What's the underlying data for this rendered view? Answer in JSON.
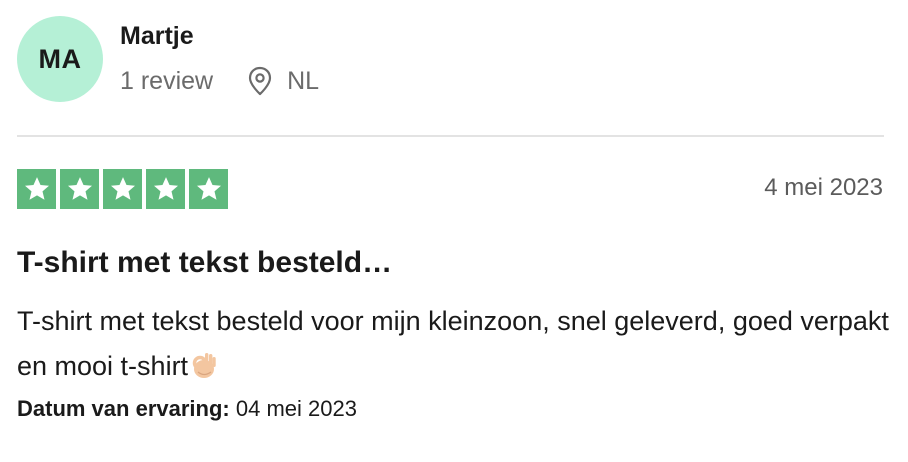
{
  "reviewer": {
    "initials": "MA",
    "name": "Martje",
    "review_count": "1 review",
    "country": "NL",
    "avatar_color": "#b5f0d6"
  },
  "review": {
    "rating": 5,
    "rating_max": 5,
    "star_color": "#5fb97d",
    "date": "4 mei 2023",
    "title": "T-shirt met tekst besteld…",
    "body": "T-shirt met tekst besteld voor mijn kleinzoon, snel geleverd, goed verpakt en mooi t-shirt",
    "body_emoji": "ok-hand-emoji",
    "experience_label": "Datum van ervaring:",
    "experience_date": "04 mei 2023"
  },
  "icons": {
    "location": "location-pin-icon",
    "star": "star-icon"
  }
}
